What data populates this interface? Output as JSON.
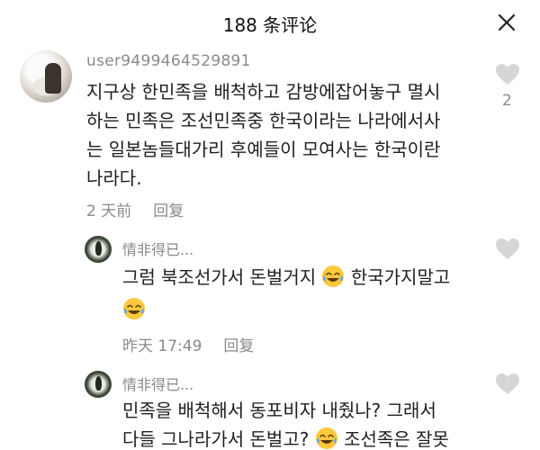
{
  "header": {
    "title": "188 条评论"
  },
  "comments": [
    {
      "username": "user9499464529891",
      "lines": [
        "지구상 한민족을 배척하고 감방에잡어놓구 멸시",
        "하는 민족은 조선민족중 한국이라는 나라에서사",
        "는 일본놈들대가리 후예들이 모여사는 한국이란",
        "나라다."
      ],
      "time": "2 天前",
      "reply_label": "回复",
      "likes": "2"
    }
  ],
  "replies": [
    {
      "username": "情非得已...",
      "line1_a": "그럼 북조선가서 돈벌거지",
      "line1_b": "한국가지말고",
      "time": "昨天 17:49",
      "reply_label": "回复"
    },
    {
      "username": "情非得已...",
      "line1": "민족을 배척해서 동포비자 내줬나? 그래서",
      "line2_a": "다들 그나라가서 돈벌고?",
      "line2_b": "조선족은 잘못"
    }
  ],
  "icons": {
    "close": "close-icon",
    "like": "heart-icon",
    "emoji": "laughing-tears-emoji"
  }
}
